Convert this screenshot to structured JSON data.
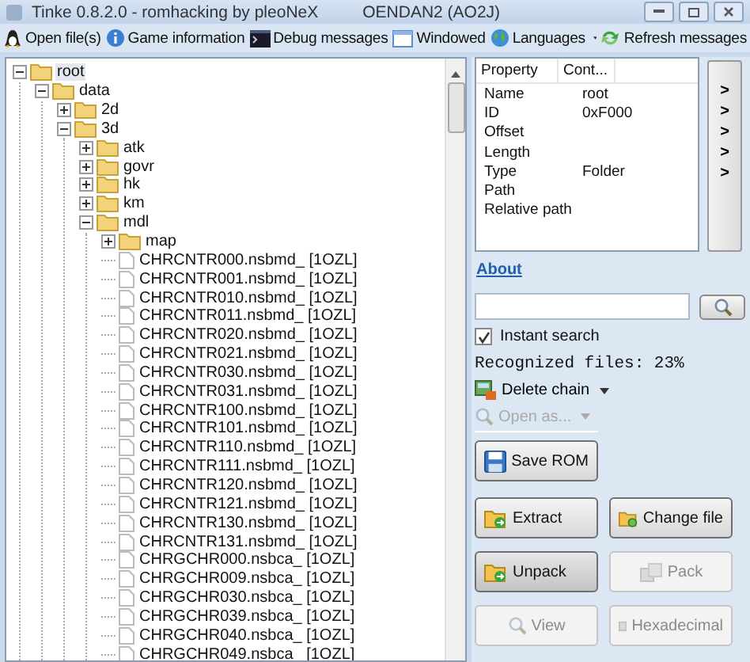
{
  "window": {
    "title": "Tinke 0.8.2.0 - romhacking by pleoNeX",
    "rom": "OENDAN2 (AO2J)"
  },
  "toolbar": [
    {
      "label": "Open file(s)"
    },
    {
      "label": "Game information"
    },
    {
      "label": "Debug messages"
    },
    {
      "label": "Windowed"
    },
    {
      "label": "Languages",
      "dropdown": true
    },
    {
      "label": "Refresh messages"
    }
  ],
  "tree": [
    {
      "label": "root",
      "kind": "folder",
      "expanded": true,
      "selected": true,
      "children": [
        {
          "label": "data",
          "kind": "folder",
          "expanded": true,
          "selected": false,
          "children": [
            {
              "label": "2d",
              "kind": "folder",
              "expanded": false,
              "selected": false
            },
            {
              "label": "3d",
              "kind": "folder",
              "expanded": true,
              "selected": false,
              "children": [
                {
                  "label": "atk",
                  "kind": "folder",
                  "expanded": false,
                  "selected": false
                },
                {
                  "label": "govr",
                  "kind": "folder",
                  "expanded": false,
                  "selected": false
                },
                {
                  "label": "hk",
                  "kind": "folder",
                  "expanded": false,
                  "selected": false
                },
                {
                  "label": "km",
                  "kind": "folder",
                  "expanded": false,
                  "selected": false
                },
                {
                  "label": "mdl",
                  "kind": "folder",
                  "expanded": true,
                  "selected": false,
                  "children": [
                    {
                      "label": "map",
                      "kind": "folder",
                      "expanded": false,
                      "selected": false
                    },
                    {
                      "label": "CHRCNTR000.nsbmd_ [1OZL]",
                      "kind": "file",
                      "selected": false
                    },
                    {
                      "label": "CHRCNTR001.nsbmd_ [1OZL]",
                      "kind": "file",
                      "selected": false
                    },
                    {
                      "label": "CHRCNTR010.nsbmd_ [1OZL]",
                      "kind": "file",
                      "selected": false
                    },
                    {
                      "label": "CHRCNTR011.nsbmd_ [1OZL]",
                      "kind": "file",
                      "selected": false
                    },
                    {
                      "label": "CHRCNTR020.nsbmd_ [1OZL]",
                      "kind": "file",
                      "selected": false
                    },
                    {
                      "label": "CHRCNTR021.nsbmd_ [1OZL]",
                      "kind": "file",
                      "selected": false
                    },
                    {
                      "label": "CHRCNTR030.nsbmd_ [1OZL]",
                      "kind": "file",
                      "selected": false
                    },
                    {
                      "label": "CHRCNTR031.nsbmd_ [1OZL]",
                      "kind": "file",
                      "selected": false
                    },
                    {
                      "label": "CHRCNTR100.nsbmd_ [1OZL]",
                      "kind": "file",
                      "selected": false
                    },
                    {
                      "label": "CHRCNTR101.nsbmd_ [1OZL]",
                      "kind": "file",
                      "selected": false
                    },
                    {
                      "label": "CHRCNTR110.nsbmd_ [1OZL]",
                      "kind": "file",
                      "selected": false
                    },
                    {
                      "label": "CHRCNTR111.nsbmd_ [1OZL]",
                      "kind": "file",
                      "selected": false
                    },
                    {
                      "label": "CHRCNTR120.nsbmd_ [1OZL]",
                      "kind": "file",
                      "selected": false
                    },
                    {
                      "label": "CHRCNTR121.nsbmd_ [1OZL]",
                      "kind": "file",
                      "selected": false
                    },
                    {
                      "label": "CHRCNTR130.nsbmd_ [1OZL]",
                      "kind": "file",
                      "selected": false
                    },
                    {
                      "label": "CHRCNTR131.nsbmd_ [1OZL]",
                      "kind": "file",
                      "selected": false
                    },
                    {
                      "label": "CHRGCHR000.nsbca_ [1OZL]",
                      "kind": "file",
                      "selected": false
                    },
                    {
                      "label": "CHRGCHR009.nsbca_ [1OZL]",
                      "kind": "file",
                      "selected": false
                    },
                    {
                      "label": "CHRGCHR030.nsbca_ [1OZL]",
                      "kind": "file",
                      "selected": false
                    },
                    {
                      "label": "CHRGCHR039.nsbca_ [1OZL]",
                      "kind": "file",
                      "selected": false
                    },
                    {
                      "label": "CHRGCHR040.nsbca_ [1OZL]",
                      "kind": "file",
                      "selected": false
                    },
                    {
                      "label": "CHRGCHR049.nsbca_ [1OZL]",
                      "kind": "file",
                      "selected": false
                    }
                  ]
                }
              ]
            }
          ]
        }
      ]
    }
  ],
  "properties": {
    "columns": [
      "Property",
      "Cont..."
    ],
    "rows": [
      [
        "Name",
        "root"
      ],
      [
        "ID",
        "0xF000"
      ],
      [
        "Offset",
        ""
      ],
      [
        "Length",
        ""
      ],
      [
        "Type",
        "Folder"
      ],
      [
        "Path",
        ""
      ],
      [
        "Relative path",
        ""
      ]
    ]
  },
  "side_buttons": [
    ">",
    ">",
    ">",
    ">",
    ">"
  ],
  "about_link": "About",
  "instant_search": {
    "label": "Instant search",
    "checked": true
  },
  "recognized": "Recognized files: 23%",
  "menus": [
    {
      "label": "Delete chain",
      "disabled": false
    },
    {
      "label": "Open as...",
      "disabled": true
    }
  ],
  "buttons": [
    {
      "label": "Save ROM",
      "disabled": false,
      "pressed": false
    },
    {
      "label": "Extract",
      "disabled": false,
      "pressed": false
    },
    {
      "label": "Change file",
      "disabled": false,
      "pressed": false
    },
    {
      "label": "Unpack",
      "disabled": false,
      "pressed": true
    },
    {
      "label": "Pack",
      "disabled": true,
      "pressed": false
    },
    {
      "label": "View",
      "disabled": true,
      "pressed": false
    },
    {
      "label": "Hexadecimal",
      "disabled": true,
      "pressed": false
    }
  ]
}
